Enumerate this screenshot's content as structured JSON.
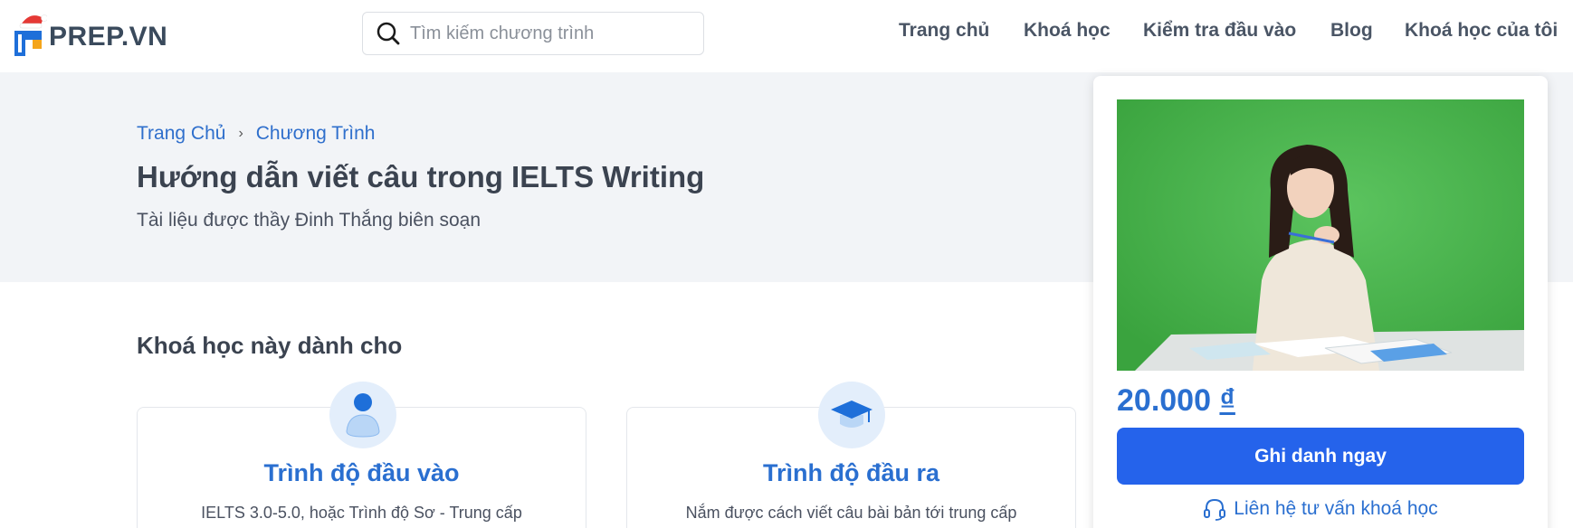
{
  "header": {
    "logo_text": "PREP.VN",
    "search_placeholder": "Tìm kiếm chương trình",
    "nav": [
      "Trang chủ",
      "Khoá học",
      "Kiểm tra đầu vào",
      "Blog",
      "Khoá học của tôi"
    ]
  },
  "hero": {
    "breadcrumb": [
      "Trang Chủ",
      "Chương Trình"
    ],
    "breadcrumb_separator": "›",
    "title": "Hướng dẫn viết câu trong IELTS Writing",
    "subtitle": "Tài liệu được thầy Đinh Thắng biên soạn"
  },
  "section": {
    "title": "Khoá học này dành cho",
    "cards": [
      {
        "icon": "person-icon",
        "title": "Trình độ đầu vào",
        "description": "IELTS 3.0-5.0, hoặc Trình độ Sơ - Trung cấp"
      },
      {
        "icon": "graduation-cap-icon",
        "title": "Trình độ đầu ra",
        "description": "Nắm được cách viết câu bài bản tới trung cấp"
      }
    ]
  },
  "sidebar": {
    "price_amount": "20.000",
    "price_currency": "₫",
    "enroll_label": "Ghi danh ngay",
    "contact_label": "Liên hệ tư vấn khoá học"
  },
  "colors": {
    "accent": "#2a6fd0",
    "button": "#2563eb",
    "hero_bg": "#f2f4f7",
    "thumb_bg": "#4cb34f"
  }
}
